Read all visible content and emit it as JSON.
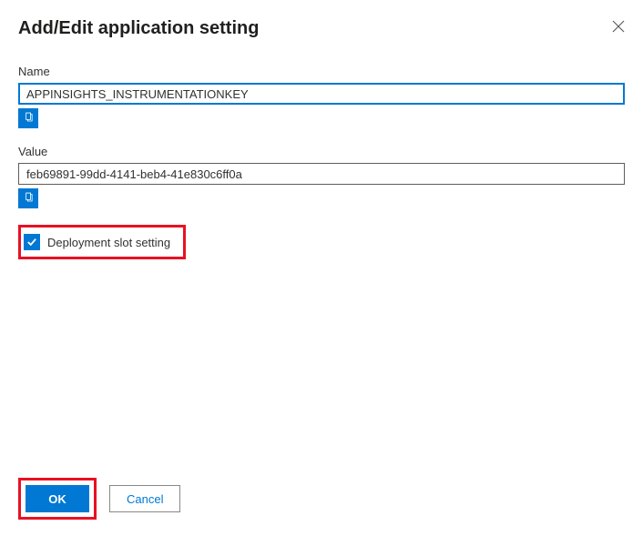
{
  "title": "Add/Edit application setting",
  "fields": {
    "name": {
      "label": "Name",
      "value": "APPINSIGHTS_INSTRUMENTATIONKEY"
    },
    "value": {
      "label": "Value",
      "value": "feb69891-99dd-4141-beb4-41e830c6ff0a"
    }
  },
  "checkbox": {
    "label": "Deployment slot setting",
    "checked": true
  },
  "buttons": {
    "ok": "OK",
    "cancel": "Cancel"
  }
}
